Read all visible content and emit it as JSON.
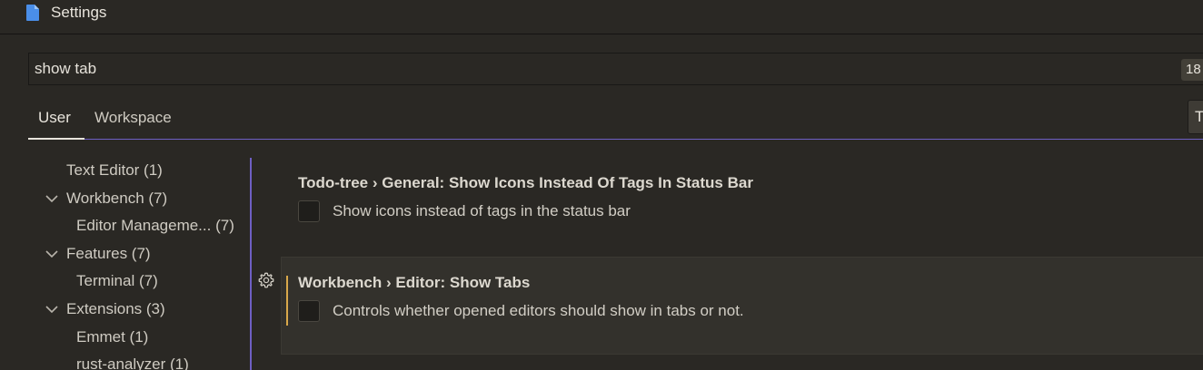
{
  "window": {
    "title": "Settings",
    "icon": "file-icon"
  },
  "search": {
    "value": "show tab",
    "result_count": "18"
  },
  "tabs": [
    {
      "label": "User",
      "active": true
    },
    {
      "label": "Workspace",
      "active": false
    }
  ],
  "toolbar": {
    "right_button_label": "T"
  },
  "toc": [
    {
      "label": "Text Editor (1)",
      "expandable": false
    },
    {
      "label": "Workbench (7)",
      "expandable": true
    },
    {
      "label": "Editor Manageme... (7)",
      "expandable": false
    },
    {
      "label": "Features (7)",
      "expandable": true
    },
    {
      "label": "Terminal (7)",
      "expandable": false
    },
    {
      "label": "Extensions (3)",
      "expandable": true
    },
    {
      "label": "Emmet (1)",
      "expandable": false
    },
    {
      "label": "rust-analyzer (1)",
      "expandable": false
    }
  ],
  "settings": [
    {
      "category": "Todo-tree › General: ",
      "name": "Show Icons Instead Of Tags In Status Bar",
      "description": "Show icons instead of tags in the status bar",
      "checked": false
    },
    {
      "category": "Workbench › Editor: ",
      "name": "Show Tabs",
      "description": "Controls whether opened editors should show in tabs or not.",
      "checked": false,
      "modified": true
    }
  ],
  "colors": {
    "accent": "#6e5fc4",
    "modified": "#d9a84a",
    "file_icon": "#4a8ee8"
  }
}
